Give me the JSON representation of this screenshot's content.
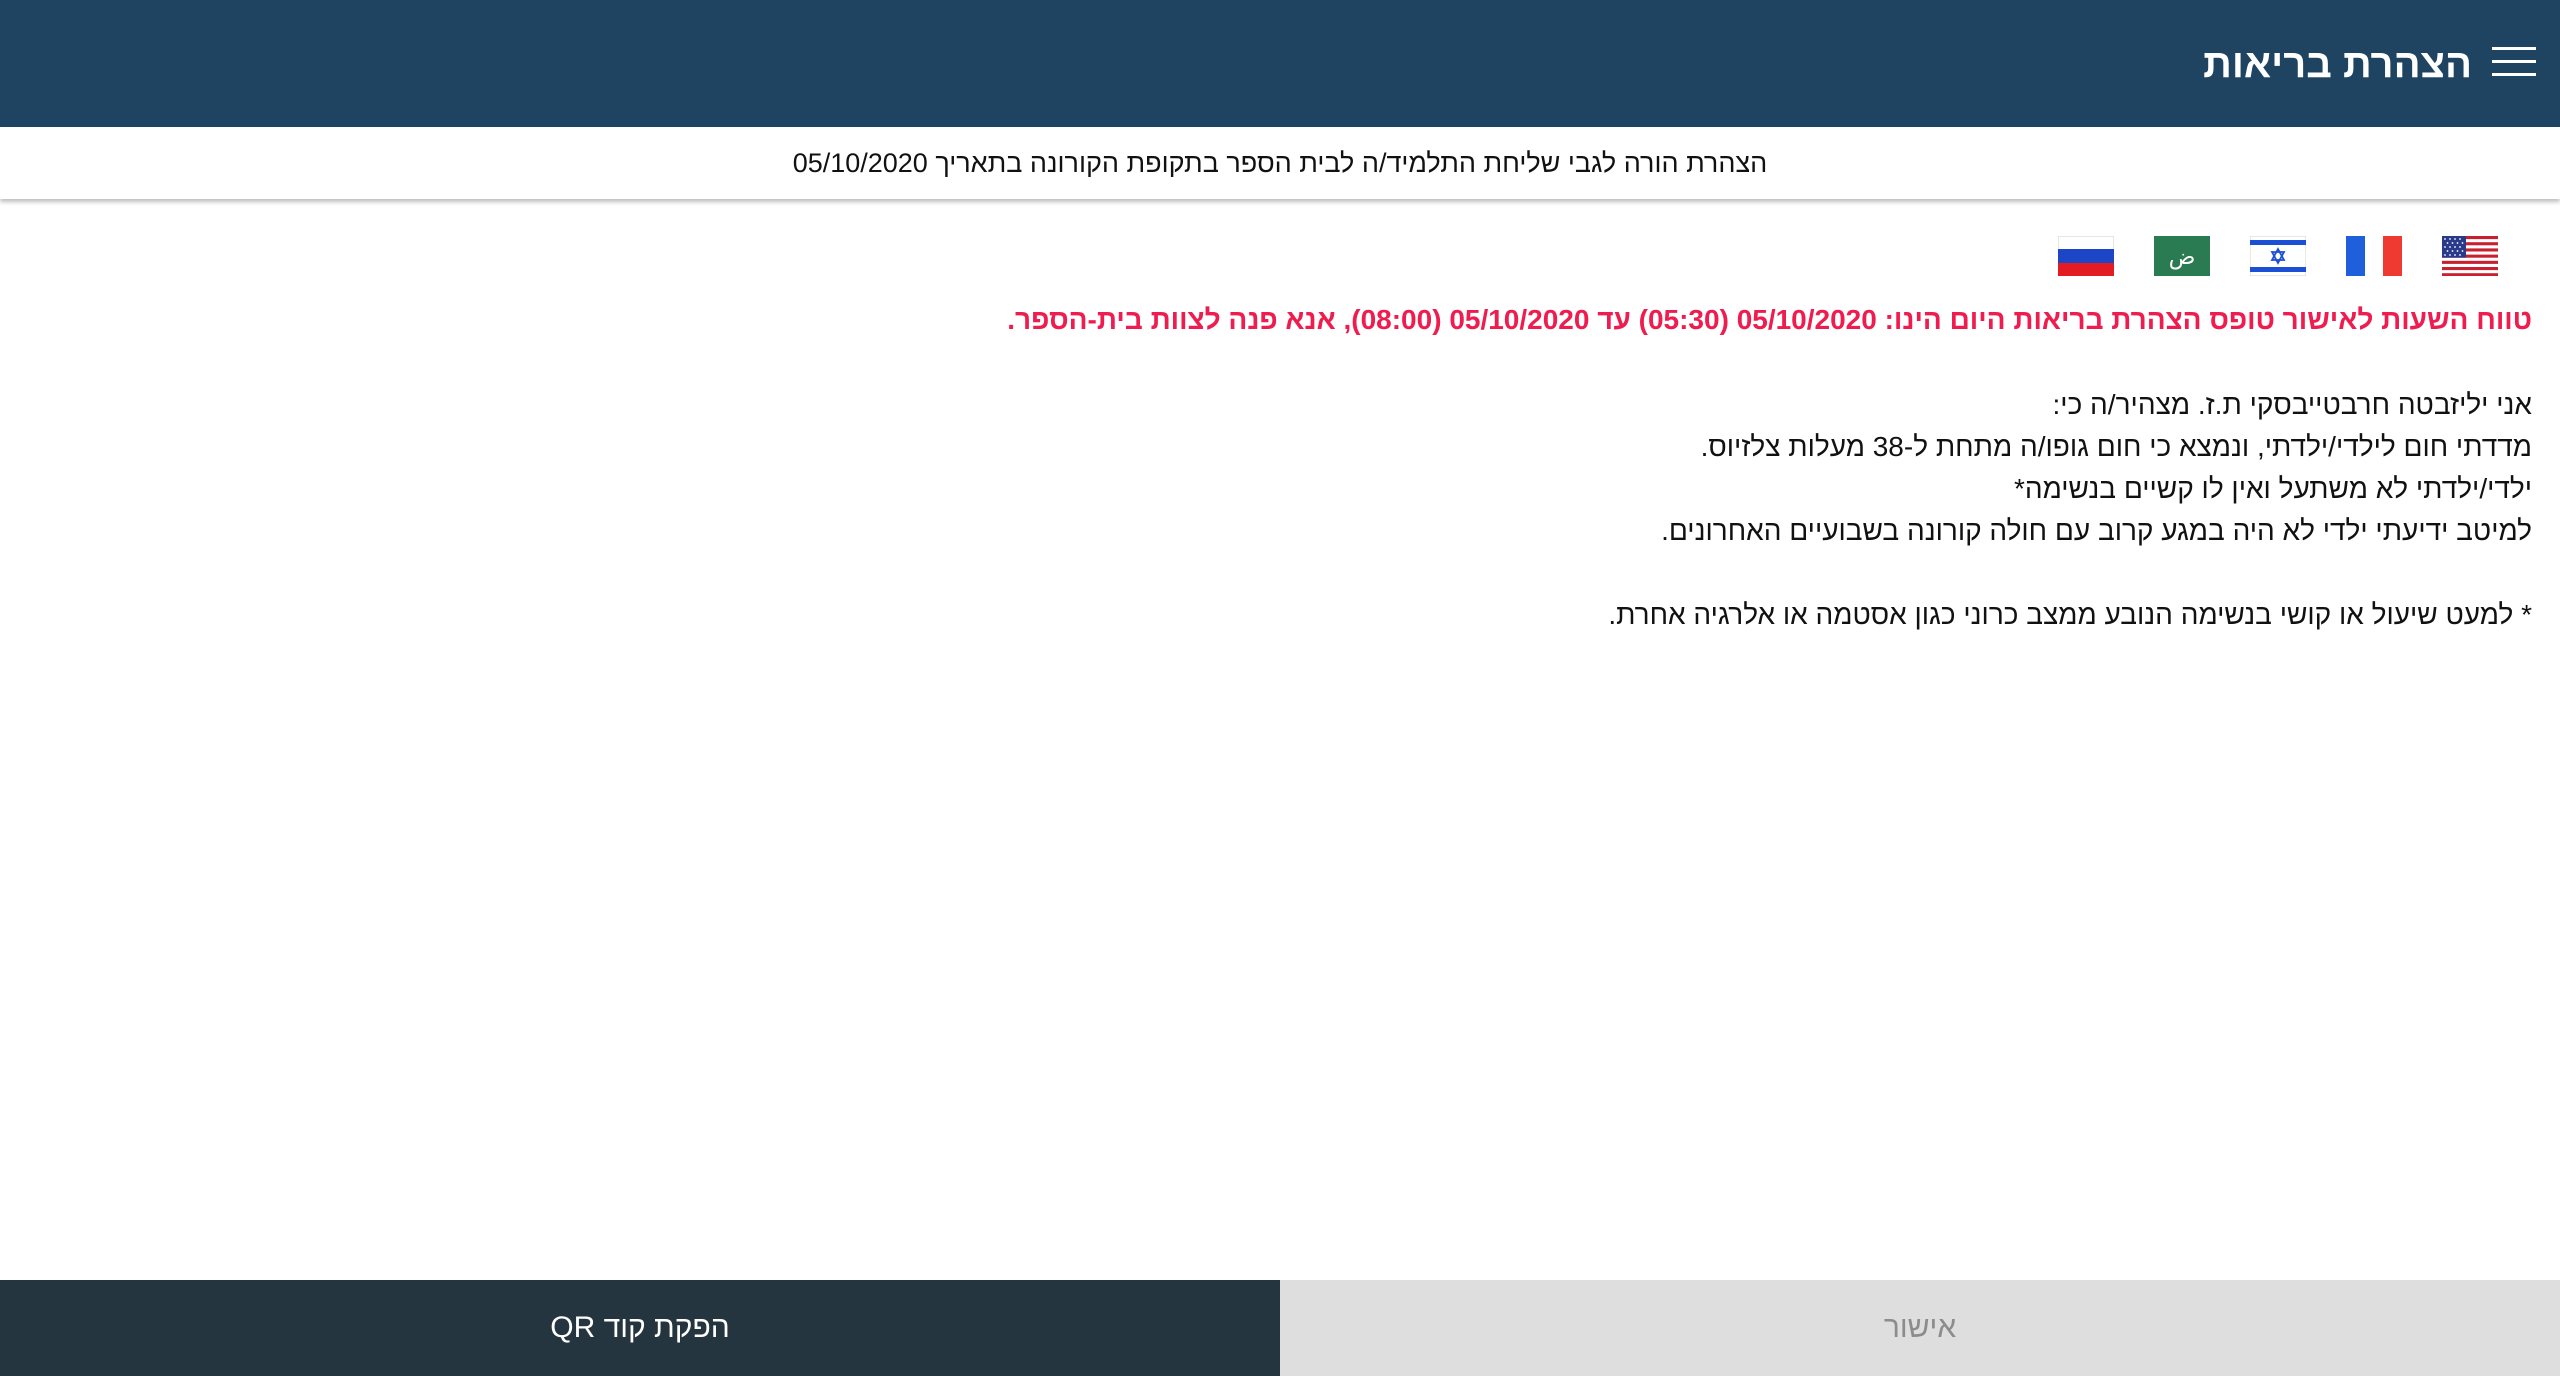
{
  "header": {
    "title": "הצהרת בריאות",
    "menu_icon": "hamburger-menu-icon",
    "background_color": "#1f4462"
  },
  "subheader": {
    "text": "הצהרת הורה לגבי שליחת התלמיד/ה לבית הספר בתקופת הקורונה בתאריך 05/10/2020"
  },
  "languages": [
    {
      "name": "english-us-flag-icon"
    },
    {
      "name": "french-flag-icon"
    },
    {
      "name": "hebrew-israel-flag-icon"
    },
    {
      "name": "arabic-flag-icon",
      "glyph": "ض"
    },
    {
      "name": "russian-flag-icon"
    }
  ],
  "declaration": {
    "warning": "טווח השעות לאישור טופס הצהרת בריאות היום הינו: 05/10/2020 (05:30) עד 05/10/2020 (08:00), אנא פנה לצוות בית-הספר.",
    "warning_color": "#ef1d4f",
    "lines": [
      "אני יליזבטה חרבטייבסקי ת.ז. מצהיר/ה כי:",
      "מדדתי חום לילדי/ילדתי, ונמצא כי חום גופו/ה מתחת ל-38 מעלות צלזיוס.",
      "ילדי/ילדתי לא משתעל ואין לו קשיים בנשימה*",
      "למיטב ידיעתי ילדי לא היה במגע קרוב עם חולה קורונה בשבועיים האחרונים."
    ],
    "footnote": "* למעט שיעול או קושי בנשימה הנובע ממצב כרוני כגון אסטמה או אלרגיה אחרת."
  },
  "buttons": {
    "qr_label": "הפקת קוד QR",
    "approve_label": "אישור"
  }
}
